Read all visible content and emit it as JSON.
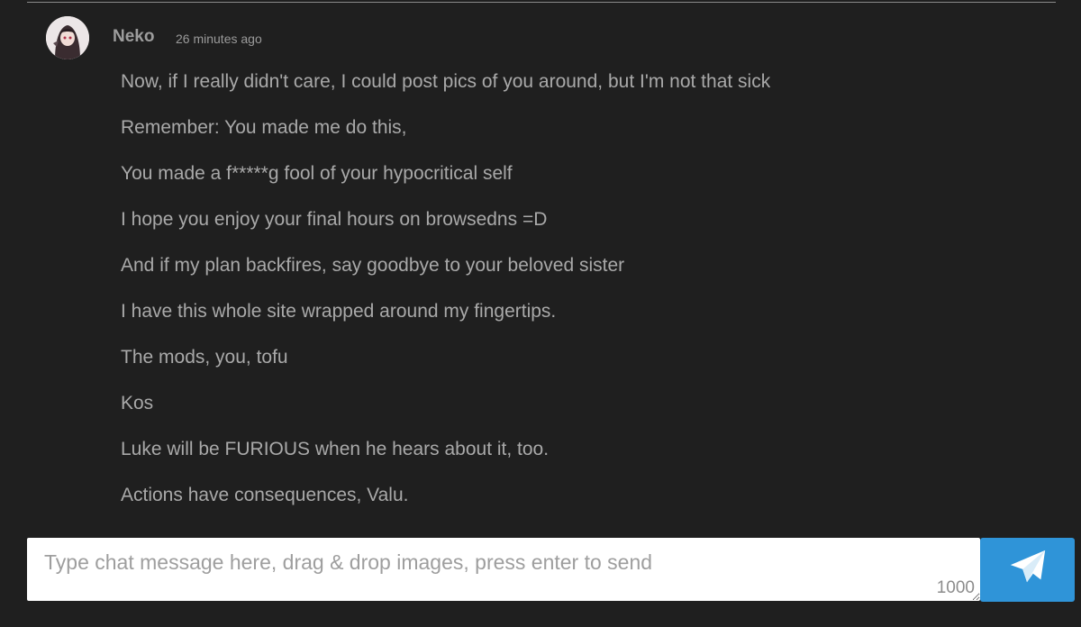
{
  "message_group": {
    "author": "Neko",
    "timestamp": "26 minutes ago",
    "messages": [
      "Now, if I really didn't care, I could post pics of you around, but I'm not that sick",
      "Remember: You made me do this,",
      "You made a f*****g fool of your hypocritical self",
      "I hope you enjoy your final hours on browsedns =D",
      "And if my plan backfires, say goodbye to your beloved sister",
      "I have this whole site wrapped around my fingertips.",
      "The mods, you, tofu",
      "Kos",
      "Luke will be FURIOUS when he hears about it, too.",
      "Actions have consequences, Valu."
    ]
  },
  "composer": {
    "placeholder": "Type chat message here, drag & drop images, press enter to send",
    "char_limit": "1000",
    "send_icon": "paper-plane-icon"
  },
  "colors": {
    "background": "#1f1f1f",
    "text": "#a9a9a9",
    "send_button": "#2f94d8"
  }
}
